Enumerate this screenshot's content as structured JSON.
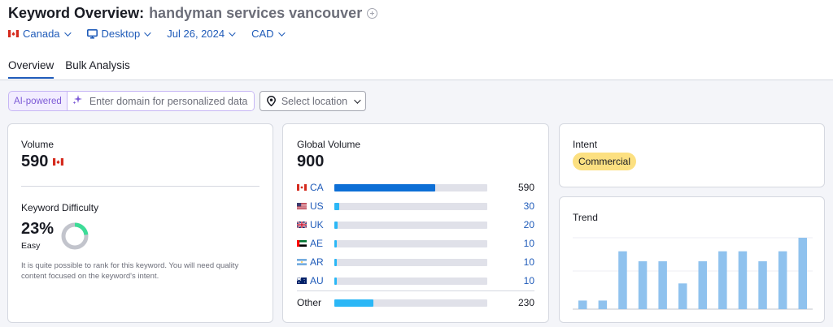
{
  "header": {
    "title": "Keyword Overview:",
    "keyword": "handyman services vancouver",
    "filters": {
      "country": "Canada",
      "device": "Desktop",
      "date": "Jul 26, 2024",
      "currency": "CAD"
    },
    "tabs": [
      "Overview",
      "Bulk Analysis"
    ]
  },
  "ai": {
    "label": "AI-powered",
    "placeholder": "Enter domain for personalized data",
    "location_label": "Select location"
  },
  "volume": {
    "title": "Volume",
    "value": "590"
  },
  "kd": {
    "title": "Keyword Difficulty",
    "value": "23%",
    "level": "Easy",
    "percent": 23,
    "note": "It is quite possible to rank for this keyword. You will need quality content focused on the keyword's intent."
  },
  "global": {
    "title": "Global Volume",
    "value": "900",
    "countries": [
      {
        "code": "CA",
        "value": "590",
        "share": 0.66
      },
      {
        "code": "US",
        "value": "30",
        "share": 0.03
      },
      {
        "code": "UK",
        "value": "20",
        "share": 0.02
      },
      {
        "code": "AE",
        "value": "10",
        "share": 0.01
      },
      {
        "code": "AR",
        "value": "10",
        "share": 0.01
      },
      {
        "code": "AU",
        "value": "10",
        "share": 0.01
      }
    ],
    "other": {
      "label": "Other",
      "value": "230",
      "share": 0.255
    }
  },
  "intent": {
    "title": "Intent",
    "badge": "Commercial"
  },
  "trend": {
    "title": "Trend",
    "relative_values": [
      0.12,
      0.12,
      0.81,
      0.67,
      0.67,
      0.36,
      0.67,
      0.81,
      0.81,
      0.67,
      0.81,
      1.0
    ]
  },
  "colors": {
    "accent": "#1f5bb9",
    "bar_primary": "#0d6fd6",
    "bar_secondary": "#2bb7f6",
    "kd_green": "#3ddc97",
    "trend_bar": "#8fc2ee"
  }
}
